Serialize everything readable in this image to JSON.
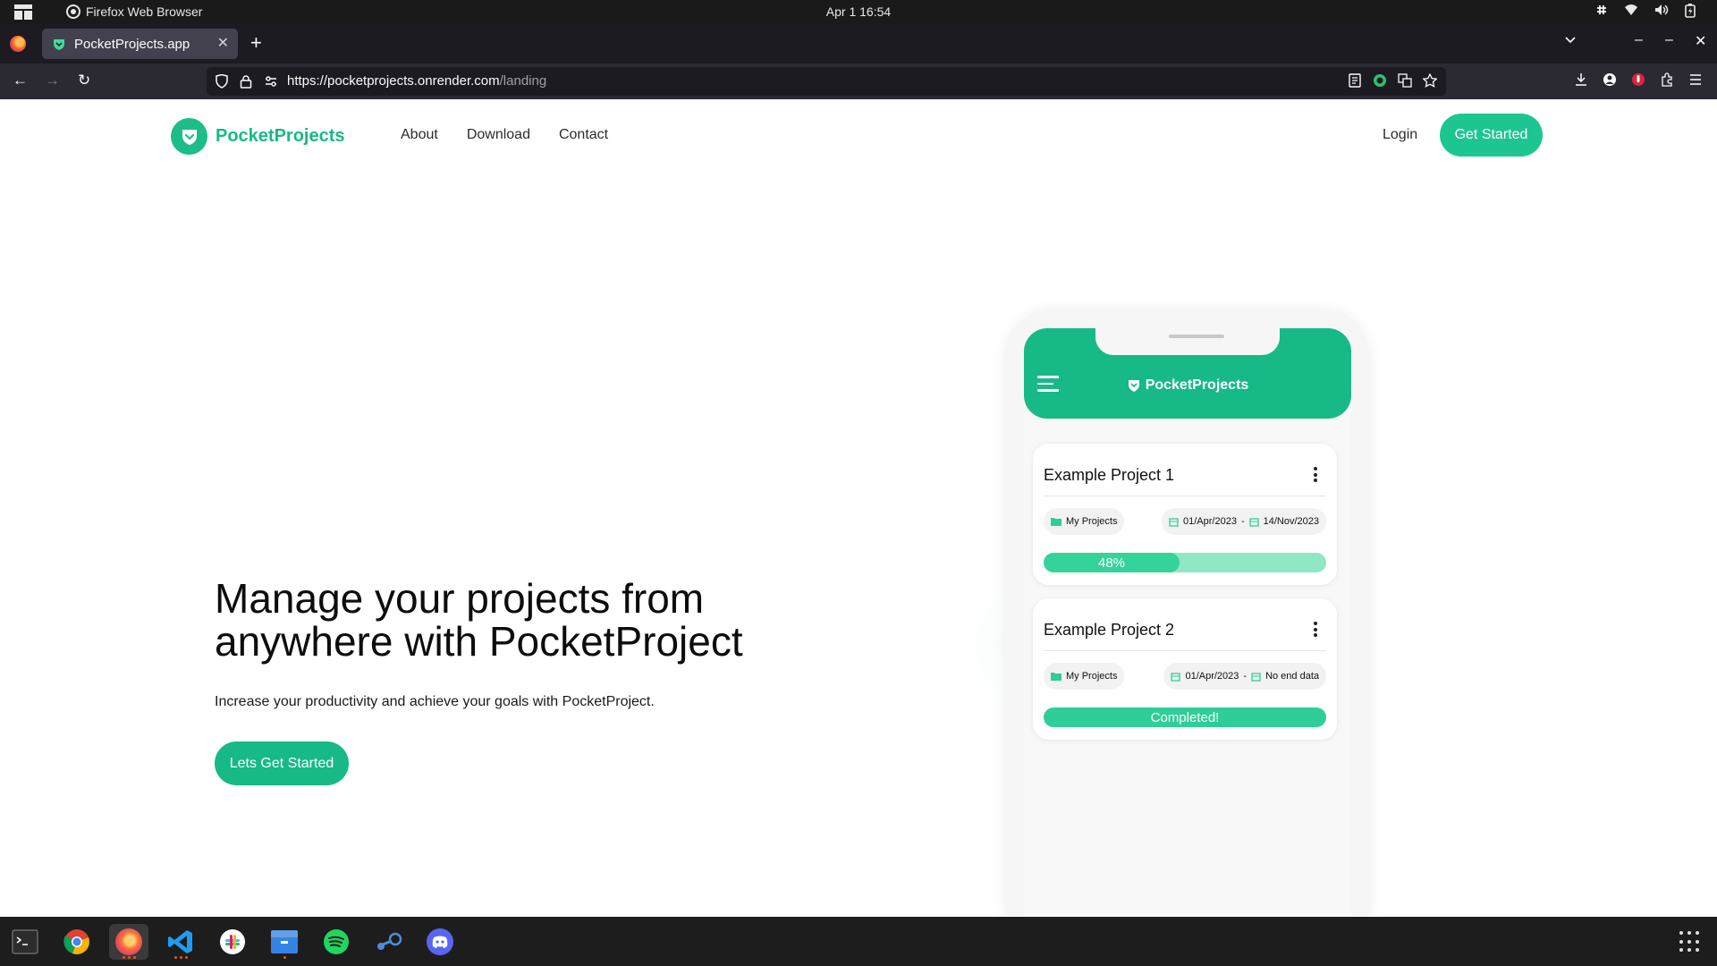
{
  "os_bar": {
    "app_name": "Firefox Web Browser",
    "clock": "Apr 1  16:54"
  },
  "browser": {
    "tab_title": "PocketProjects.app",
    "url_host": "https://pocketprojects.onrender.com",
    "url_path": "/landing"
  },
  "site": {
    "brand": "PocketProjects",
    "nav": [
      "About",
      "Download",
      "Contact"
    ],
    "login": "Login",
    "get_started": "Get Started",
    "accent_color": "#17b987"
  },
  "hero": {
    "title": "Manage your projects from anywhere with PocketProject",
    "subtitle": "Increase your productivity and achieve your goals with PocketProject.",
    "cta": "Lets Get Started"
  },
  "phone": {
    "brand": "PocketProjects",
    "projects": [
      {
        "title": "Example Project 1",
        "folder": "My Projects",
        "start_date": "01/Apr/2023",
        "end_date": "14/Nov/2023",
        "progress_percent": 48,
        "progress_label": "48%"
      },
      {
        "title": "Example Project 2",
        "folder": "My Projects",
        "start_date": "01/Apr/2023",
        "end_date": "No end data",
        "progress_percent": 100,
        "progress_label": "Completed!"
      }
    ]
  },
  "taskbar": {
    "apps": [
      "terminal",
      "chrome",
      "firefox",
      "vscode",
      "slack",
      "files",
      "spotify",
      "steam",
      "discord"
    ]
  }
}
